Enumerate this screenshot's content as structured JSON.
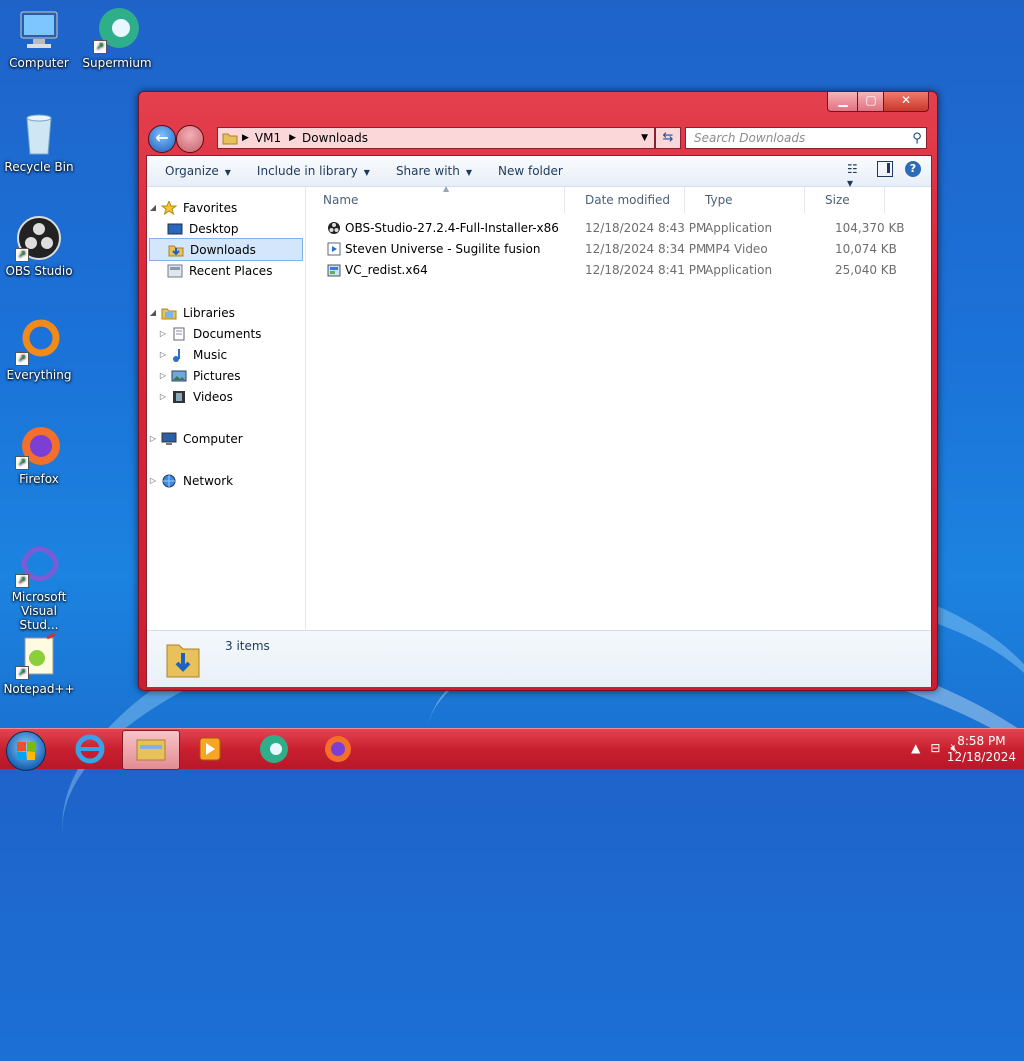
{
  "desktop": {
    "icons": [
      {
        "label": "Computer",
        "icon": "computer-icon"
      },
      {
        "label": "Supermium",
        "icon": "supermium-icon"
      },
      {
        "label": "Recycle Bin",
        "icon": "recycle-bin-icon"
      },
      {
        "label": "OBS Studio",
        "icon": "obs-icon"
      },
      {
        "label": "Everything",
        "icon": "everything-icon"
      },
      {
        "label": "Firefox",
        "icon": "firefox-icon"
      },
      {
        "label": "Microsoft Visual Stud...",
        "icon": "visual-studio-icon"
      },
      {
        "label": "Notepad++",
        "icon": "notepadpp-icon"
      }
    ]
  },
  "window": {
    "address": {
      "root": "VM1",
      "folder": "Downloads"
    },
    "search_placeholder": "Search Downloads",
    "toolbar": {
      "organize": "Organize",
      "include_in_library": "Include in library",
      "share_with": "Share with",
      "new_folder": "New folder"
    },
    "nav": {
      "favorites": "Favorites",
      "desktop": "Desktop",
      "downloads": "Downloads",
      "recent_places": "Recent Places",
      "libraries": "Libraries",
      "documents": "Documents",
      "music": "Music",
      "pictures": "Pictures",
      "videos": "Videos",
      "computer": "Computer",
      "network": "Network"
    },
    "columns": {
      "name": "Name",
      "date": "Date modified",
      "type": "Type",
      "size": "Size"
    },
    "files": [
      {
        "name": "OBS-Studio-27.2.4-Full-Installer-x86",
        "date": "12/18/2024 8:43 PM",
        "type": "Application",
        "size": "104,370 KB"
      },
      {
        "name": "Steven Universe - Sugilite fusion",
        "date": "12/18/2024 8:34 PM",
        "type": "MP4 Video",
        "size": "10,074 KB"
      },
      {
        "name": "VC_redist.x64",
        "date": "12/18/2024 8:41 PM",
        "type": "Application",
        "size": "25,040 KB"
      }
    ],
    "details": {
      "item_count": "3 items"
    }
  },
  "taskbar": {
    "time": "8:58 PM",
    "date": "12/18/2024"
  },
  "colors": {
    "window_frame": "#d9283a",
    "taskbar": "#c9202f",
    "selection": "#d3e6fb"
  }
}
